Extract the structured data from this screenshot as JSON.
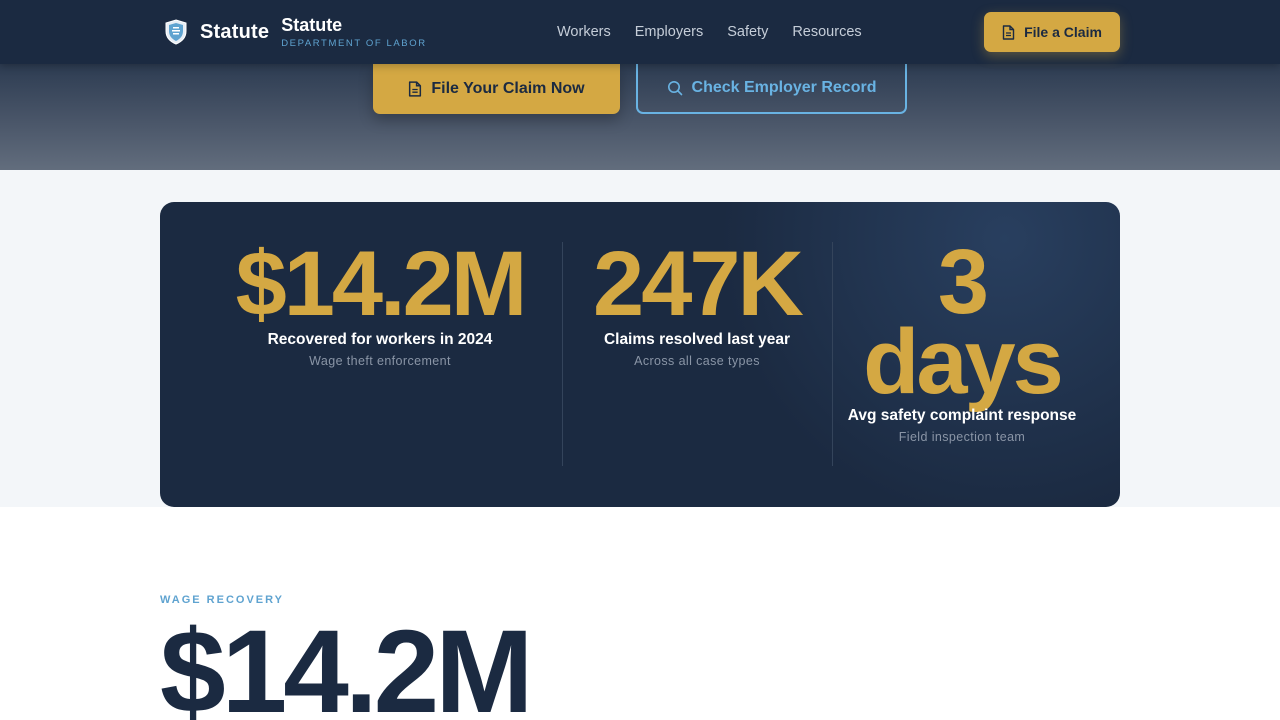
{
  "nav": {
    "brand_name": "Statute",
    "brand_sub_title": "Statute",
    "brand_sub_caption": "DEPARTMENT OF LABOR",
    "links": [
      "Workers",
      "Employers",
      "Safety",
      "Resources"
    ],
    "cta_label": "File a Claim"
  },
  "hero": {
    "primary_label": "File Your Claim Now",
    "secondary_label": "Check Employer Record"
  },
  "stats": [
    {
      "value": "$14.2M",
      "label": "Recovered for workers in 2024",
      "note": "Wage theft enforcement"
    },
    {
      "value": "247K",
      "label": "Claims resolved last year",
      "note": "Across all case types"
    },
    {
      "value_line1": "3",
      "value_line2": "days",
      "label": "Avg safety complaint response",
      "note": "Field inspection team"
    }
  ],
  "wage_recovery": {
    "eyebrow": "WAGE RECOVERY",
    "value": "$14.2M"
  },
  "colors": {
    "navy": "#1b2a41",
    "gold": "#d4a843",
    "sky": "#5fa3d0",
    "band": "#f3f6f9"
  },
  "icons": [
    "shield-icon",
    "document-icon",
    "search-icon"
  ]
}
